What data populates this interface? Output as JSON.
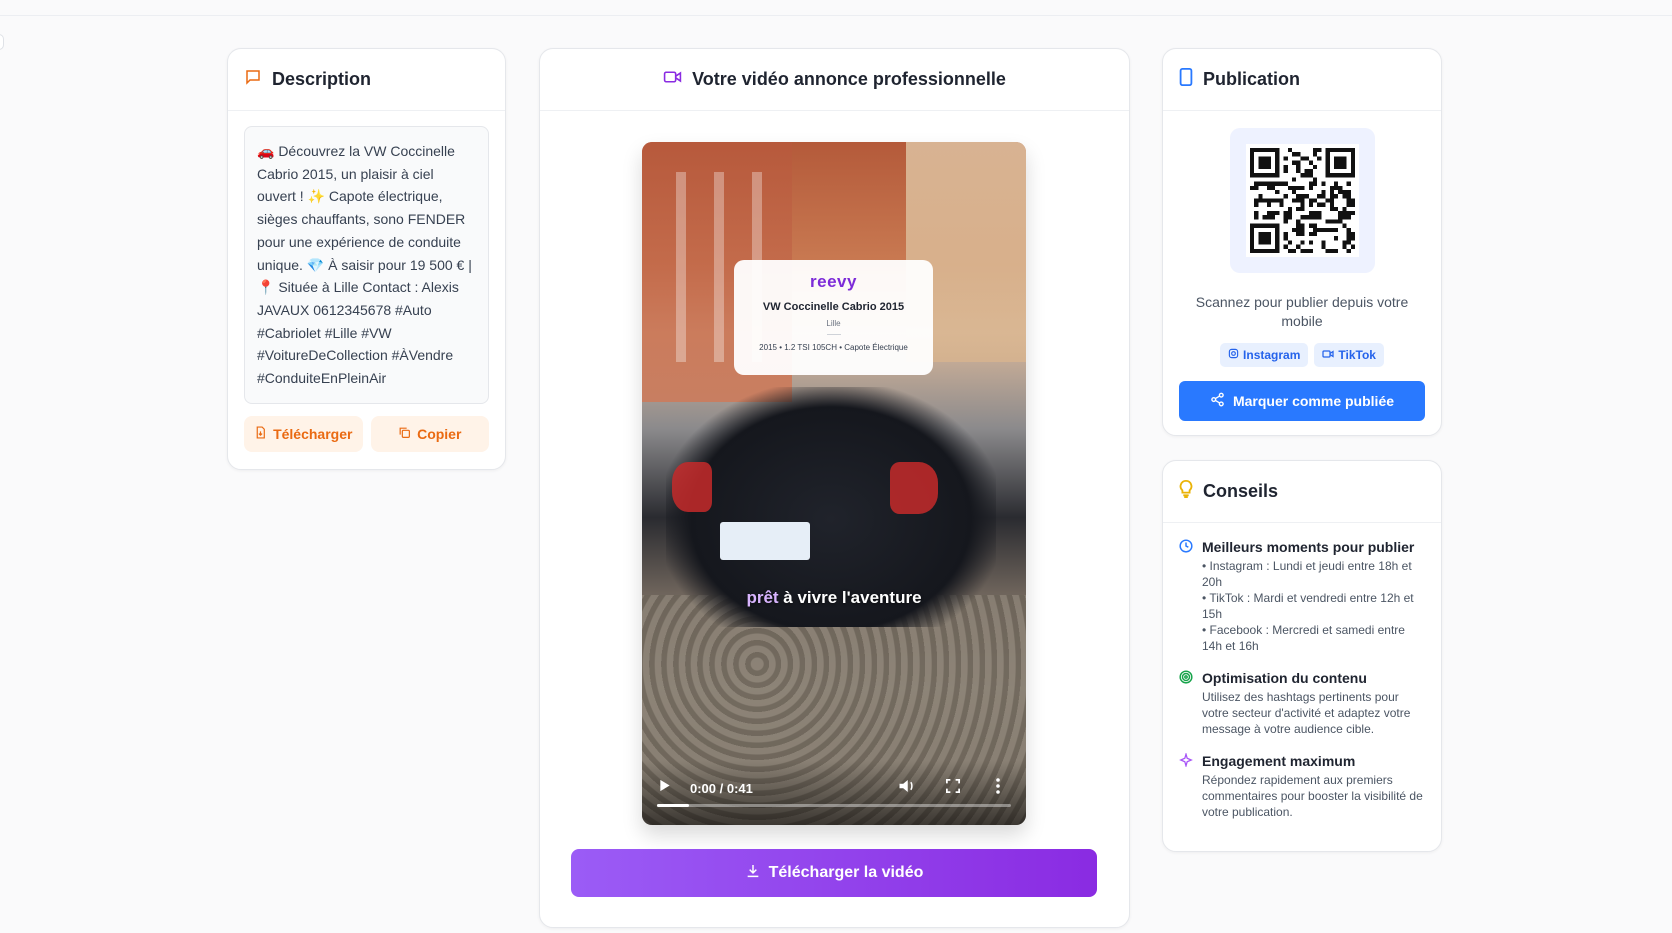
{
  "description": {
    "title": "Description",
    "text": "🚗 Découvrez la VW Coccinelle Cabrio 2015, un plaisir à ciel ouvert ! ✨ Capote électrique, sièges chauffants, sono FENDER pour une expérience de conduite unique. 💎 À saisir pour 19 500 € | 📍 Située à Lille Contact : Alexis JAVAUX 0612345678 #Auto #Cabriolet #Lille #VW #VoitureDeCollection #ÀVendre #ConduiteEnPleinAir",
    "download_label": "Télécharger",
    "copy_label": "Copier"
  },
  "video": {
    "title": "Votre vidéo annonce professionnelle",
    "overlay": {
      "brand": "reevy",
      "title": "VW Coccinelle Cabrio 2015",
      "city": "Lille",
      "specs": "2015 • 1.2 TSI 105CH • Capote Électrique"
    },
    "caption_highlight": "prêt",
    "caption_rest": " à vivre l'aventure",
    "time": "0:00 / 0:41",
    "progress": 0.09,
    "download_label": "Télécharger la vidéo"
  },
  "publication": {
    "title": "Publication",
    "scan_text": "Scannez pour publier depuis votre mobile",
    "chips": [
      "Instagram",
      "TikTok"
    ],
    "mark_label": "Marquer comme publiée"
  },
  "tips": {
    "title": "Conseils",
    "items": [
      {
        "title": "Meilleurs moments pour publier",
        "lines": [
          "• Instagram : Lundi et jeudi entre 18h et 20h",
          "• TikTok : Mardi et vendredi entre 12h et 15h",
          "• Facebook : Mercredi et samedi entre 14h et 16h"
        ]
      },
      {
        "title": "Optimisation du contenu",
        "lines": [
          "Utilisez des hashtags pertinents pour votre secteur d'activité et adaptez votre message à votre audience cible."
        ]
      },
      {
        "title": "Engagement maximum",
        "lines": [
          "Répondez rapidement aux premiers commentaires pour booster la visibilité de votre publication."
        ]
      }
    ]
  },
  "colors": {
    "orange": "#ea6a12",
    "purple": "#8a2be2",
    "blue": "#2979ff"
  }
}
